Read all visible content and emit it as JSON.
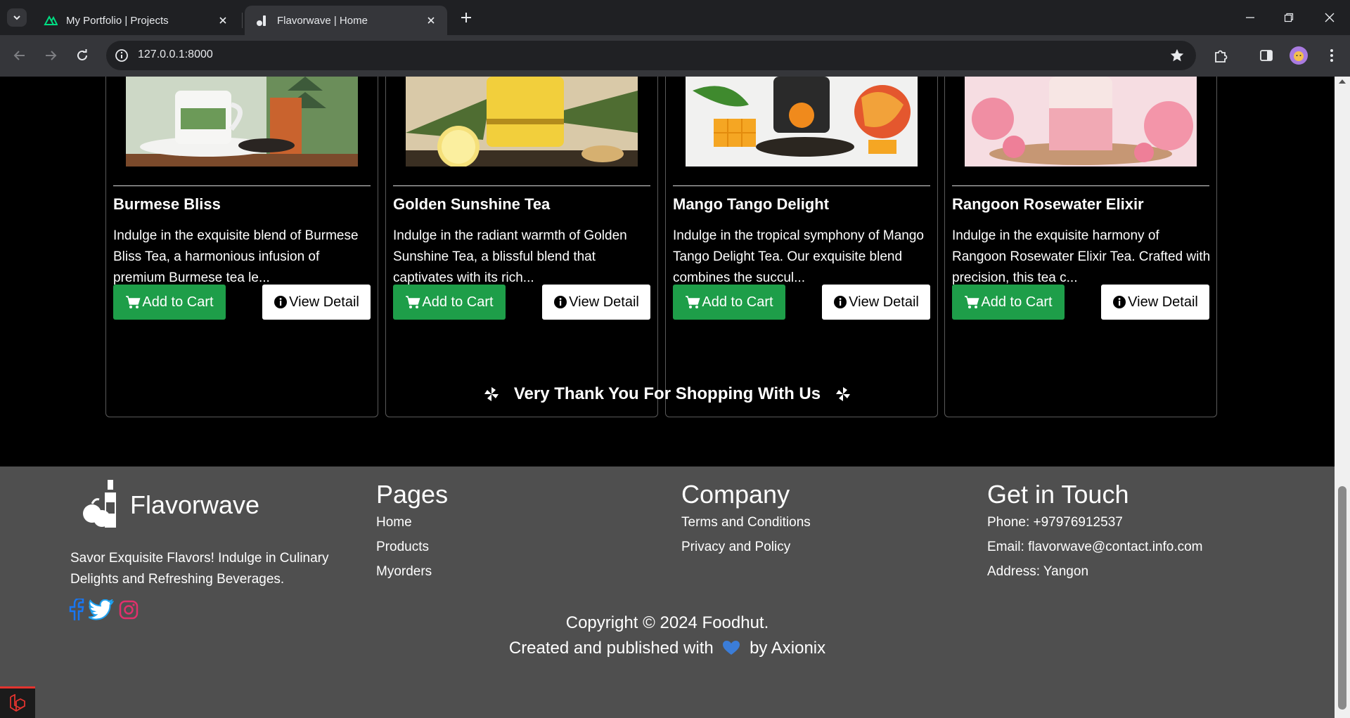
{
  "browser": {
    "tabs": [
      {
        "title": "My Portfolio | Projects",
        "active": false
      },
      {
        "title": "Flavorwave | Home",
        "active": true
      }
    ],
    "url": "127.0.0.1:8000"
  },
  "products": [
    {
      "name": "Burmese Bliss",
      "description": "Indulge in the exquisite blend of Burmese Bliss Tea, a harmonious infusion of premium Burmese tea le..."
    },
    {
      "name": "Golden Sunshine Tea",
      "description": "Indulge in the radiant warmth of Golden Sunshine Tea, a blissful blend that captivates with its rich..."
    },
    {
      "name": "Mango Tango Delight",
      "description": "Indulge in the tropical symphony of Mango Tango Delight Tea. Our exquisite blend combines the succul..."
    },
    {
      "name": "Rangoon Rosewater Elixir",
      "description": "Indulge in the exquisite harmony of Rangoon Rosewater Elixir Tea. Crafted with precision, this tea c..."
    }
  ],
  "buttons": {
    "add_to_cart": "Add to Cart",
    "view_detail": "View Detail"
  },
  "thanks_text": "Very Thank You For Shopping With Us",
  "footer": {
    "brand": "Flavorwave",
    "tagline": "Savor Exquisite Flavors! Indulge in Culinary Delights and Refreshing Beverages.",
    "pages": {
      "heading": "Pages",
      "links": [
        "Home",
        "Products",
        "Myorders"
      ]
    },
    "company": {
      "heading": "Company",
      "links": [
        "Terms and Conditions",
        "Privacy and Policy"
      ]
    },
    "contact": {
      "heading": "Get in Touch",
      "lines": [
        "Phone: +97976912537",
        "Email: flavorwave@contact.info.com",
        "Address: Yangon"
      ]
    },
    "copyright": "Copyright © 2024 Foodhut.",
    "created_prefix": "Created and published with",
    "created_suffix": "by Axionix"
  },
  "colors": {
    "cart_green": "#1e9e49",
    "footer_bg": "#4f4f4f",
    "page_bg": "#000000",
    "heart": "#3b7dd8",
    "instagram": "#e1306c",
    "facebook": "#1877f2",
    "twitter": "#1da1f2"
  }
}
